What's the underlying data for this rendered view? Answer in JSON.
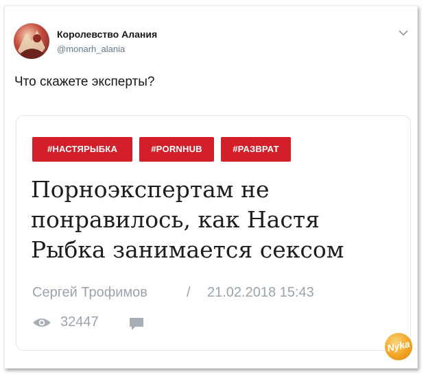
{
  "tweet": {
    "author": {
      "display_name": "Королевство Алания",
      "handle": "@monarh_alania"
    },
    "text": "Что скажете эксперты?",
    "menu_icon": "chevron-down-icon"
  },
  "card": {
    "tags": [
      "#НАСТЯРЫБКА",
      "#PORNHUB",
      "#РАЗВРАТ"
    ],
    "headline_lines": [
      "Порноэкспертам не",
      "понравилось, как Настя",
      "Рыбка занимается сексом"
    ],
    "author": "Сергей Трофимов",
    "separator": "/",
    "datetime": "21.02.2018 15:43",
    "views": "32447",
    "watermark_text": "Nyka"
  },
  "colors": {
    "tag_bg": "#d21f2a",
    "meta_text": "#9aa3ad",
    "handle_text": "#657786"
  }
}
